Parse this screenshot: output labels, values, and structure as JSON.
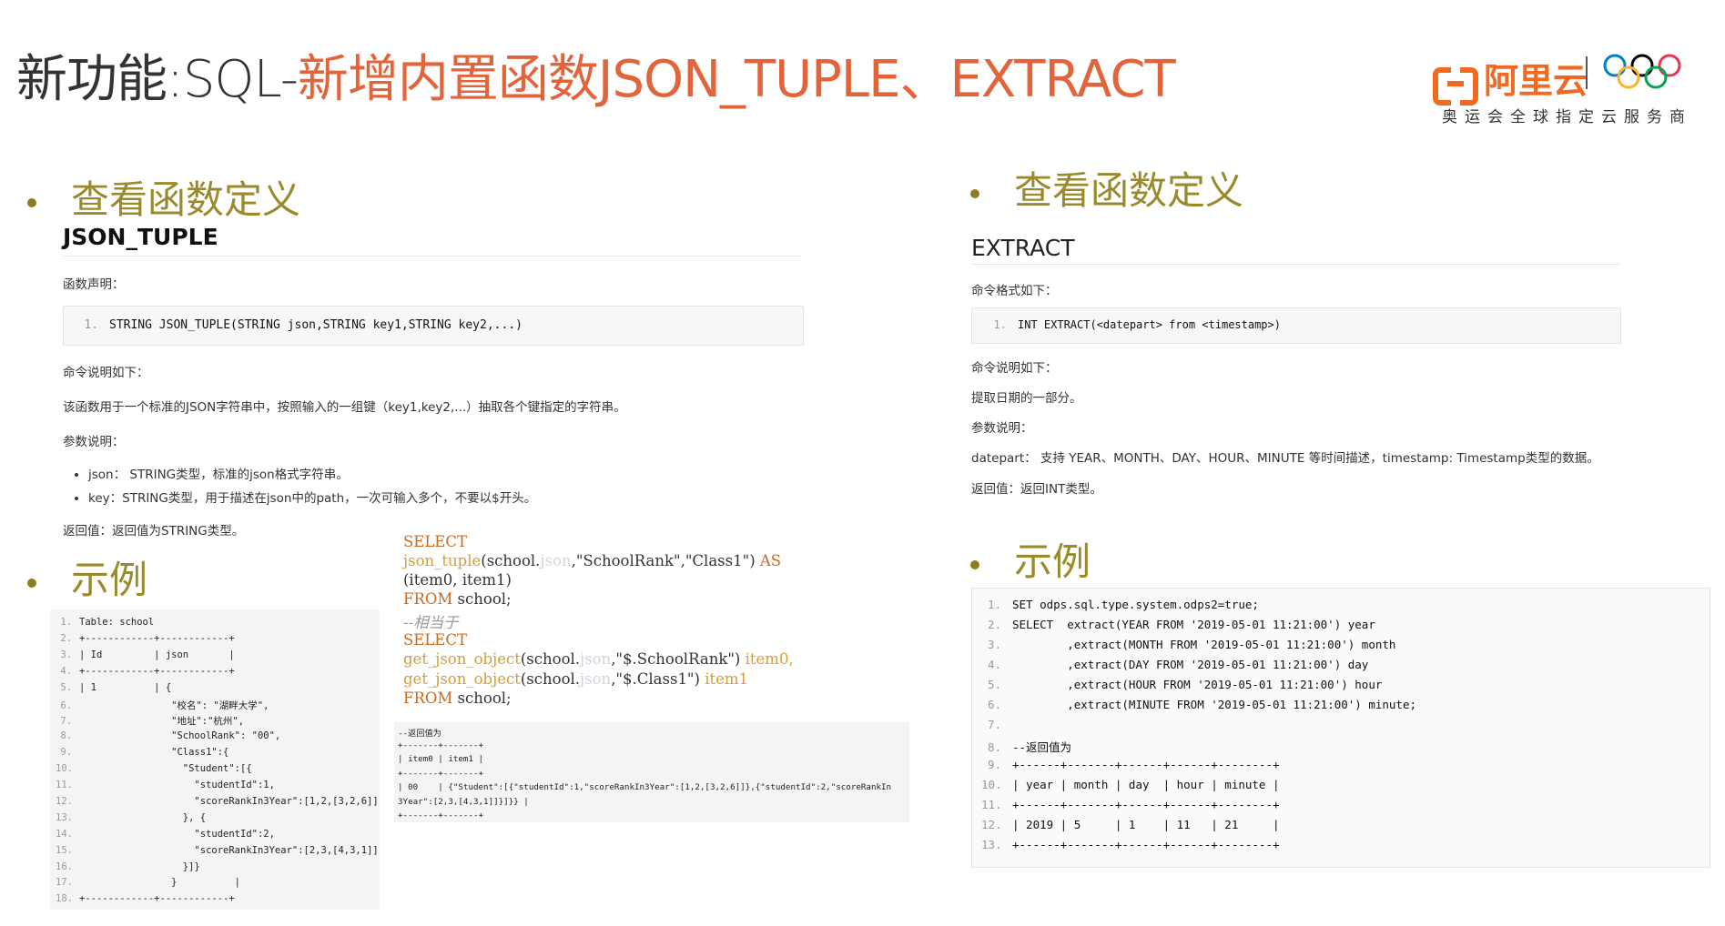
{
  "title": {
    "part1": "新功能",
    "part2": ":SQL-",
    "part3": "新增内置函数JSON_TUPLE、EXTRACT"
  },
  "logo": {
    "brand": "阿里云",
    "tagline": "奥运会全球指定云服务商",
    "olympic_ring_colors": [
      "#0081c8",
      "#000000",
      "#ee334e",
      "#fcb131",
      "#00a651"
    ]
  },
  "left": {
    "heading": "查看函数定义",
    "subheading": "JSON_TUPLE",
    "decl_label": "函数声明：",
    "decl_code": {
      "num": "1.",
      "text": "STRING JSON_TUPLE(STRING json,STRING key1,STRING key2,...)"
    },
    "desc_label": "命令说明如下：",
    "desc_text": "该函数用于一个标准的JSON字符串中，按照输入的一组键（key1,key2,...）抽取各个键指定的字符串。",
    "param_label": "参数说明：",
    "params": [
      "json： STRING类型，标准的json格式字符串。",
      "key：STRING类型，用于描述在json中的path，一次可输入多个，不要以$开头。"
    ],
    "return_text": "返回值：返回值为STRING类型。",
    "example_heading": "示例",
    "table_lines": [
      {
        "n": "1.",
        "t": "Table: school"
      },
      {
        "n": "2.",
        "t": "+------------+------------+"
      },
      {
        "n": "3.",
        "t": "| Id         | json       |"
      },
      {
        "n": "4.",
        "t": "+------------+------------+"
      },
      {
        "n": "5.",
        "t": "| 1          | {"
      },
      {
        "n": "6.",
        "t": "                \"校名\": \"湖畔大学\","
      },
      {
        "n": "7.",
        "t": "                \"地址\":\"杭州\","
      },
      {
        "n": "8.",
        "t": "                \"SchoolRank\": \"00\","
      },
      {
        "n": "9.",
        "t": "                \"Class1\":{"
      },
      {
        "n": "10.",
        "t": "                  \"Student\":[{"
      },
      {
        "n": "11.",
        "t": "                    \"studentId\":1,"
      },
      {
        "n": "12.",
        "t": "                    \"scoreRankIn3Year\":[1,2,[3,2,6]]"
      },
      {
        "n": "13.",
        "t": "                  }, {"
      },
      {
        "n": "14.",
        "t": "                    \"studentId\":2,"
      },
      {
        "n": "15.",
        "t": "                    \"scoreRankIn3Year\":[2,3,[4,3,1]]"
      },
      {
        "n": "16.",
        "t": "                  }]}"
      },
      {
        "n": "17.",
        "t": "                }          |"
      },
      {
        "n": "18.",
        "t": "+------------+------------+"
      }
    ]
  },
  "middle": {
    "sql1_select": "SELECT",
    "sql1_fn": "json_tuple",
    "sql1_args_a": "(school.",
    "sql1_args_json": "json",
    "sql1_args_b": ",\"SchoolRank\",\"Class1\")",
    "sql1_as": "AS",
    "sql1_alias": "(item0, item1)",
    "sql1_from": "FROM",
    "sql1_table": "school;",
    "equiv_comment": "--相当于",
    "sql2_select": "SELECT",
    "sql2_fn1": "get_json_object",
    "sql2_args1_a": "(school.",
    "sql2_args1_json": "json",
    "sql2_args1_b": ",\"$.SchoolRank\")",
    "sql2_alias1": "item0,",
    "sql2_fn2": "get_json_object",
    "sql2_args2_a": "(school.",
    "sql2_args2_json": "json",
    "sql2_args2_b": ",\"$.Class1\")",
    "sql2_alias2": "item1",
    "sql2_from": "FROM",
    "sql2_table": "school;",
    "result_lines": [
      "--返回值为",
      "+-------+-------+",
      "| item0 | item1 |",
      "+-------+-------+",
      "| 00    | {\"Student\":[{\"studentId\":1,\"scoreRankIn3Year\":[1,2,[3,2,6]]},{\"studentId\":2,\"scoreRankIn",
      "3Year\":[2,3,[4,3,1]]}]}} |",
      "+-------+-------+"
    ]
  },
  "right": {
    "heading": "查看函数定义",
    "subheading": "EXTRACT",
    "format_label": "命令格式如下：",
    "format_code": {
      "num": "1.",
      "text": "INT EXTRACT(<datepart> from <timestamp>)"
    },
    "desc_label": "命令说明如下：",
    "desc_text": "提取日期的一部分。",
    "param_label": "参数说明：",
    "param_text": "datepart： 支持 YEAR、MONTH、DAY、HOUR、MINUTE 等时间描述，timestamp: Timestamp类型的数据。",
    "return_text": "返回值：返回INT类型。",
    "example_heading": "示例",
    "example_lines": [
      {
        "n": "1.",
        "t": "SET odps.sql.type.system.odps2=true;"
      },
      {
        "n": "2.",
        "t": "SELECT  extract(YEAR FROM '2019-05-01 11:21:00') year"
      },
      {
        "n": "3.",
        "t": "        ,extract(MONTH FROM '2019-05-01 11:21:00') month"
      },
      {
        "n": "4.",
        "t": "        ,extract(DAY FROM '2019-05-01 11:21:00') day"
      },
      {
        "n": "5.",
        "t": "        ,extract(HOUR FROM '2019-05-01 11:21:00') hour"
      },
      {
        "n": "6.",
        "t": "        ,extract(MINUTE FROM '2019-05-01 11:21:00') minute;"
      },
      {
        "n": "7.",
        "t": ""
      },
      {
        "n": "8.",
        "t": "--返回值为"
      },
      {
        "n": "9.",
        "t": "+------+-------+------+------+--------+"
      },
      {
        "n": "10.",
        "t": "| year | month | day  | hour | minute |"
      },
      {
        "n": "11.",
        "t": "+------+-------+------+------+--------+"
      },
      {
        "n": "12.",
        "t": "| 2019 | 5     | 1    | 11   | 21     |"
      },
      {
        "n": "13.",
        "t": "+------+-------+------+------+--------+"
      }
    ]
  }
}
